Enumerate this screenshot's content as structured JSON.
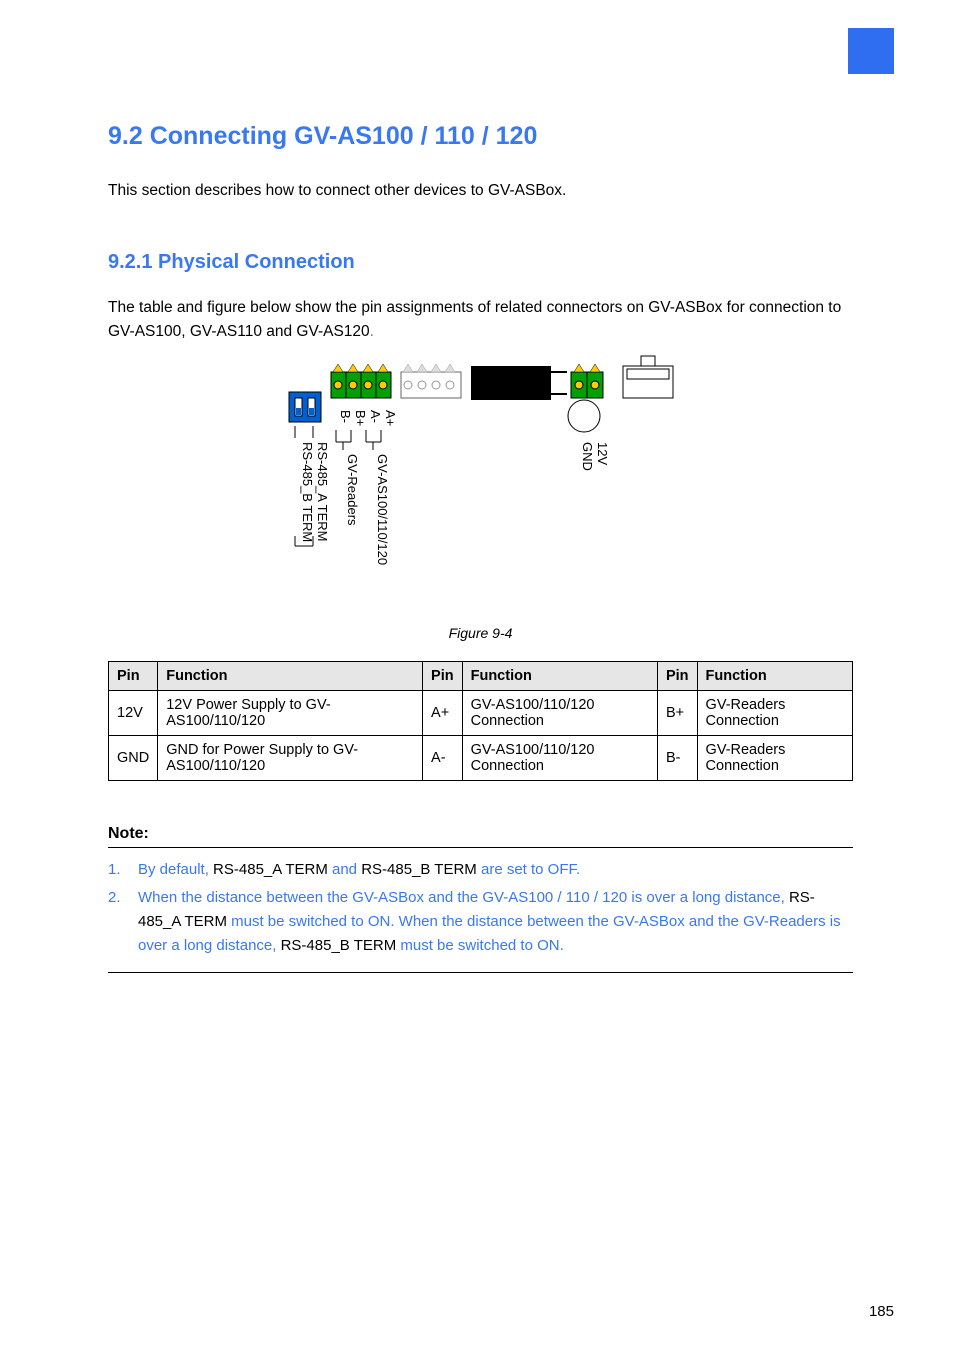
{
  "headerSquare": {
    "color": "#2f6ef0"
  },
  "section": {
    "title": "9.2 Connecting GV-AS100 / 110 / 120",
    "intro": "This section describes how to connect other devices to GV-ASBox."
  },
  "subsection": {
    "title": "9.2.1 Physical Connection",
    "intro_black": "The table and figure below show the pin assignments of related connectors on GV-ASBox for connection to GV-AS100, GV-AS110 and GV-AS120",
    "intro_blue": "."
  },
  "figure": {
    "labels": {
      "aplus": "A+",
      "aminus": "A-",
      "bplus": "B+",
      "bminus": "B-",
      "gv_as": "GV-AS100/110/120",
      "gv_readers": "GV-Readers",
      "rs485a": "RS-485_A TERM",
      "rs485b": "RS-485_B TERM",
      "gnd": "GND",
      "v12": "12V"
    },
    "caption": "Figure 9-4"
  },
  "table": {
    "headers": [
      "Pin",
      "Function",
      "Pin",
      "Function",
      "Pin",
      "Function"
    ],
    "rows": [
      {
        "c1": "12V",
        "c2": "12V Power Supply to GV-AS100/110/120",
        "c3": "A+",
        "c4": "GV-AS100/110/120 Connection",
        "c5": "B+",
        "c6": "GV-Readers Connection"
      },
      {
        "c1": "GND",
        "c2": "GND for Power Supply to GV-AS100/110/120",
        "c3": "A-",
        "c4": "GV-AS100/110/120 Connection",
        "c5": "B-",
        "c6": "GV-Readers Connection"
      }
    ]
  },
  "note": {
    "label": "Note:",
    "items": [
      {
        "num": "1.",
        "parts": [
          {
            "t": "By default, ",
            "c": "blue"
          },
          {
            "t": "RS-485_A TERM",
            "c": ""
          },
          {
            "t": " and ",
            "c": "blue"
          },
          {
            "t": "RS-485_B TERM",
            "c": ""
          },
          {
            "t": " are set to OFF.",
            "c": "blue"
          }
        ]
      },
      {
        "num": "2.",
        "parts": [
          {
            "t": "When the distance between the GV-ASBox and the GV-AS100 / 110 / 120 is over a long distance, ",
            "c": "blue"
          },
          {
            "t": "RS-485_A TERM",
            "c": ""
          },
          {
            "t": " must be switched to ON. When the distance between the GV-ASBox and the GV-Readers is over a long distance, ",
            "c": "blue"
          },
          {
            "t": "RS-485_B TERM",
            "c": ""
          },
          {
            "t": " must be switched to ON.",
            "c": "blue"
          }
        ]
      }
    ]
  },
  "pageNumber": "185"
}
